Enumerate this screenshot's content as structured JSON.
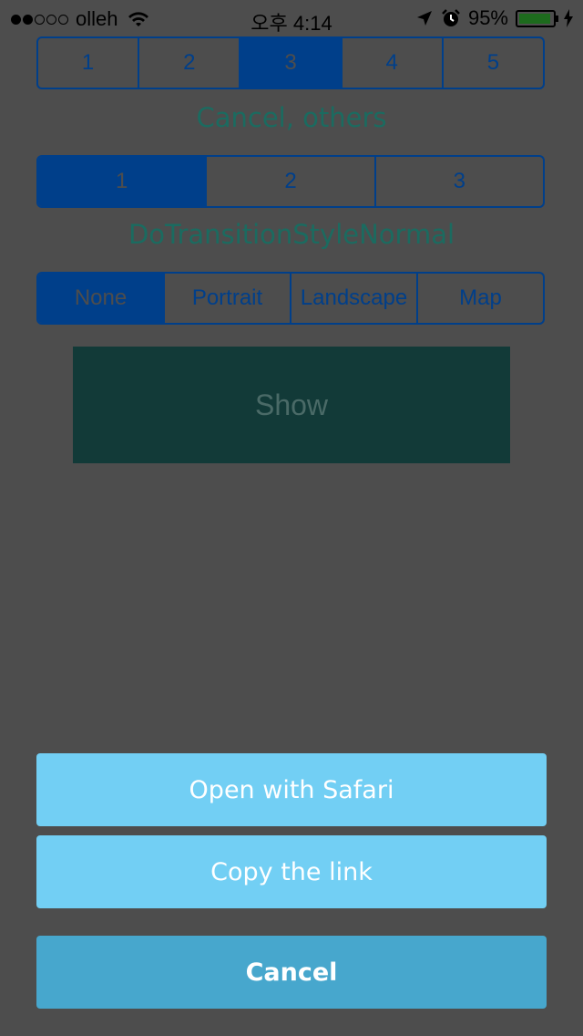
{
  "status_bar": {
    "carrier": "olleh",
    "time": "오후 4:14",
    "battery": "95%",
    "battery_level": 0.95,
    "signal_bars": 2,
    "signal_total": 5
  },
  "segment_controls": [
    {
      "items": [
        "1",
        "2",
        "3",
        "4",
        "5"
      ],
      "selected_index": 2
    },
    {
      "items": [
        "1",
        "2",
        "3"
      ],
      "selected_index": 0
    },
    {
      "items": [
        "None",
        "Portrait",
        "Landscape",
        "Map"
      ],
      "selected_index": 0
    }
  ],
  "captions": {
    "first": "Cancel, others",
    "second": "DoTransitionStyleNormal"
  },
  "show_button": {
    "label": "Show"
  },
  "action_sheet": {
    "open_safari": "Open with Safari",
    "copy_link": "Copy the link",
    "cancel": "Cancel"
  },
  "colors": {
    "dim_background": "#4d4d4d",
    "segment_tint": "#003f8a",
    "sheet_button": "#72cff4",
    "sheet_cancel": "#47a7cd"
  },
  "icons": [
    "wifi-icon",
    "location-arrow-icon",
    "alarm-icon",
    "battery-icon",
    "charging-bolt-icon"
  ]
}
